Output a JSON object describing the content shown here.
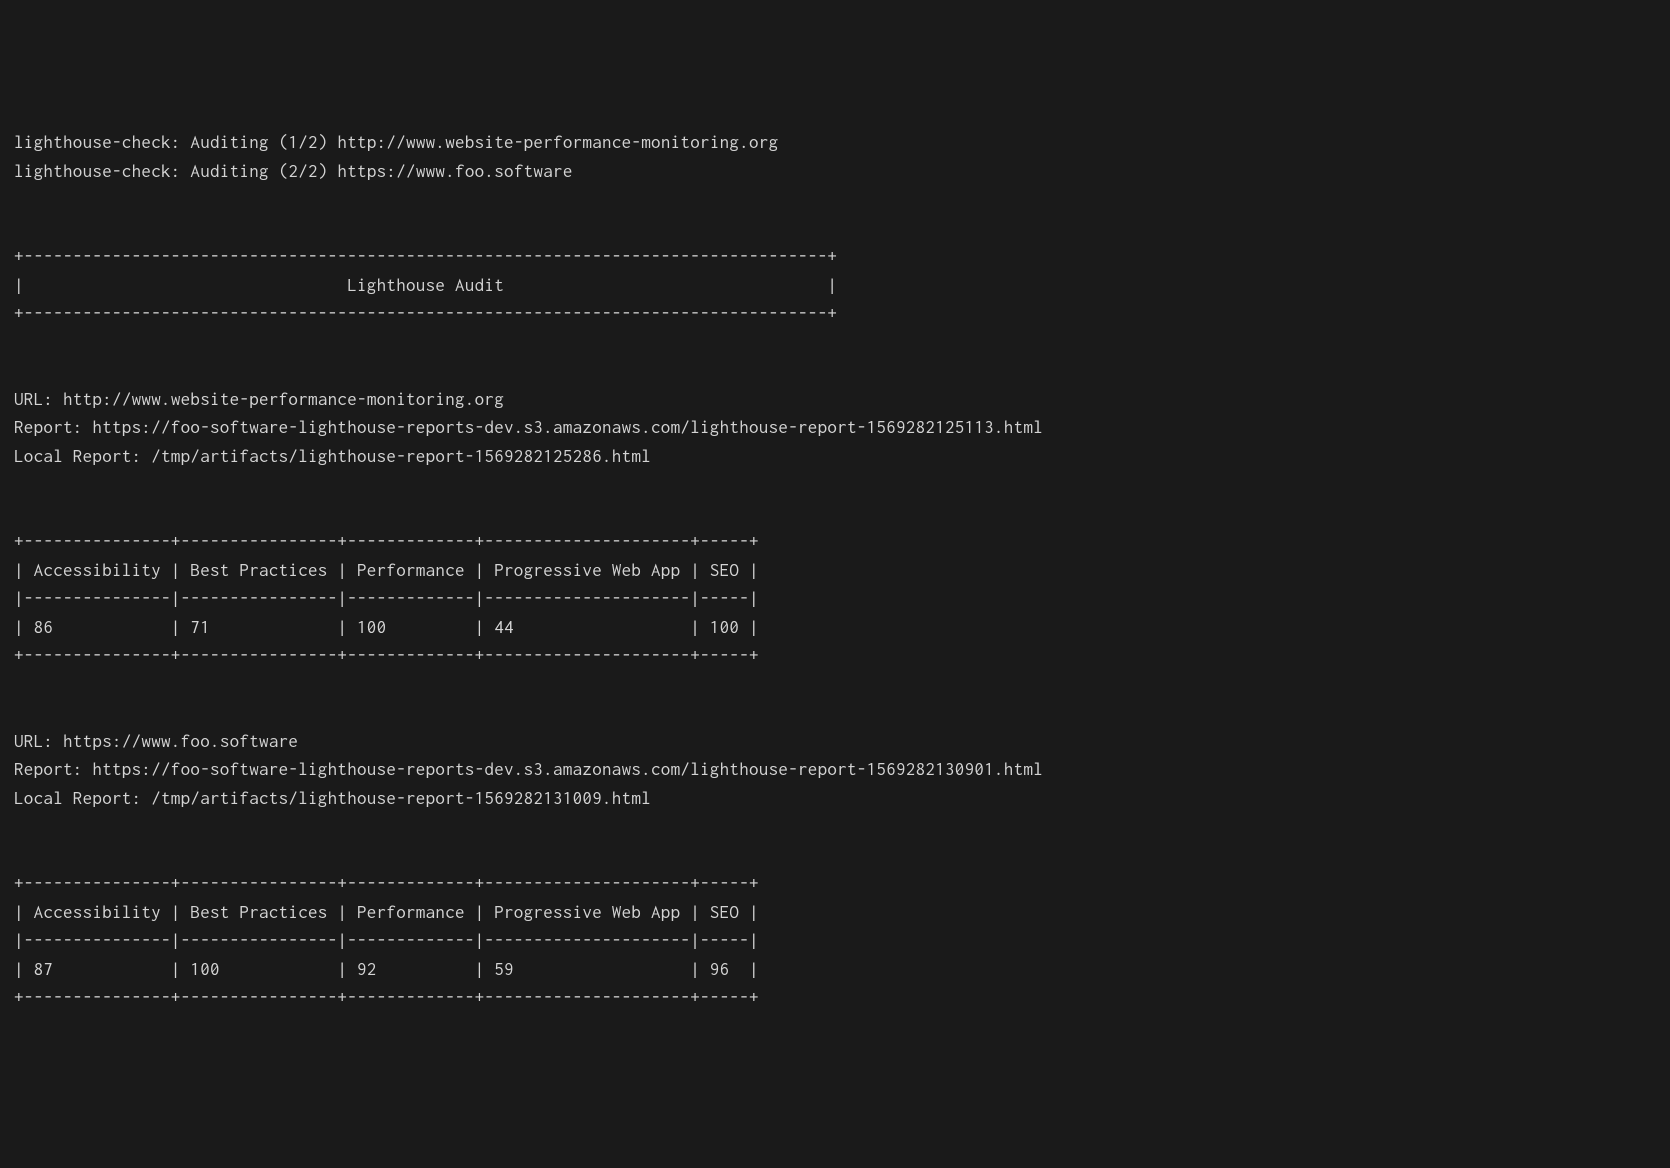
{
  "program_name": "lighthouse-check",
  "audit_lines": [
    {
      "prefix": "lighthouse-check: ",
      "action": "Auditing (1/2) ",
      "url": "http://www.website-performance-monitoring.org"
    },
    {
      "prefix": "lighthouse-check: ",
      "action": "Auditing (2/2) ",
      "url": "https://www.foo.software"
    }
  ],
  "header_box": {
    "top": "+----------------------------------------------------------------------------------+",
    "title": "|                                 Lighthouse Audit                                 |",
    "bottom": "+----------------------------------------------------------------------------------+"
  },
  "reports": [
    {
      "url_label": "URL: ",
      "url": "http://www.website-performance-monitoring.org",
      "report_label": "Report: ",
      "report": "https://foo-software-lighthouse-reports-dev.s3.amazonaws.com/lighthouse-report-1569282125113.html",
      "local_label": "Local Report: ",
      "local": "/tmp/artifacts/lighthouse-report-1569282125286.html",
      "table": {
        "border_top": "+---------------+----------------+-------------+---------------------+-----+",
        "headers": "| Accessibility | Best Practices | Performance | Progressive Web App | SEO |",
        "separator": "|---------------|----------------|-------------|---------------------|-----|",
        "values": "| 86            | 71             | 100         | 44                  | 100 |",
        "border_bot": "+---------------+----------------+-------------+---------------------+-----+",
        "columns": [
          "Accessibility",
          "Best Practices",
          "Performance",
          "Progressive Web App",
          "SEO"
        ],
        "scores": [
          86,
          71,
          100,
          44,
          100
        ]
      }
    },
    {
      "url_label": "URL: ",
      "url": "https://www.foo.software",
      "report_label": "Report: ",
      "report": "https://foo-software-lighthouse-reports-dev.s3.amazonaws.com/lighthouse-report-1569282130901.html",
      "local_label": "Local Report: ",
      "local": "/tmp/artifacts/lighthouse-report-1569282131009.html",
      "table": {
        "border_top": "+---------------+----------------+-------------+---------------------+-----+",
        "headers": "| Accessibility | Best Practices | Performance | Progressive Web App | SEO |",
        "separator": "|---------------|----------------|-------------|---------------------|-----|",
        "values": "| 87            | 100            | 92          | 59                  | 96  |",
        "border_bot": "+---------------+----------------+-------------+---------------------+-----+",
        "columns": [
          "Accessibility",
          "Best Practices",
          "Performance",
          "Progressive Web App",
          "SEO"
        ],
        "scores": [
          87,
          100,
          92,
          59,
          96
        ]
      }
    }
  ]
}
